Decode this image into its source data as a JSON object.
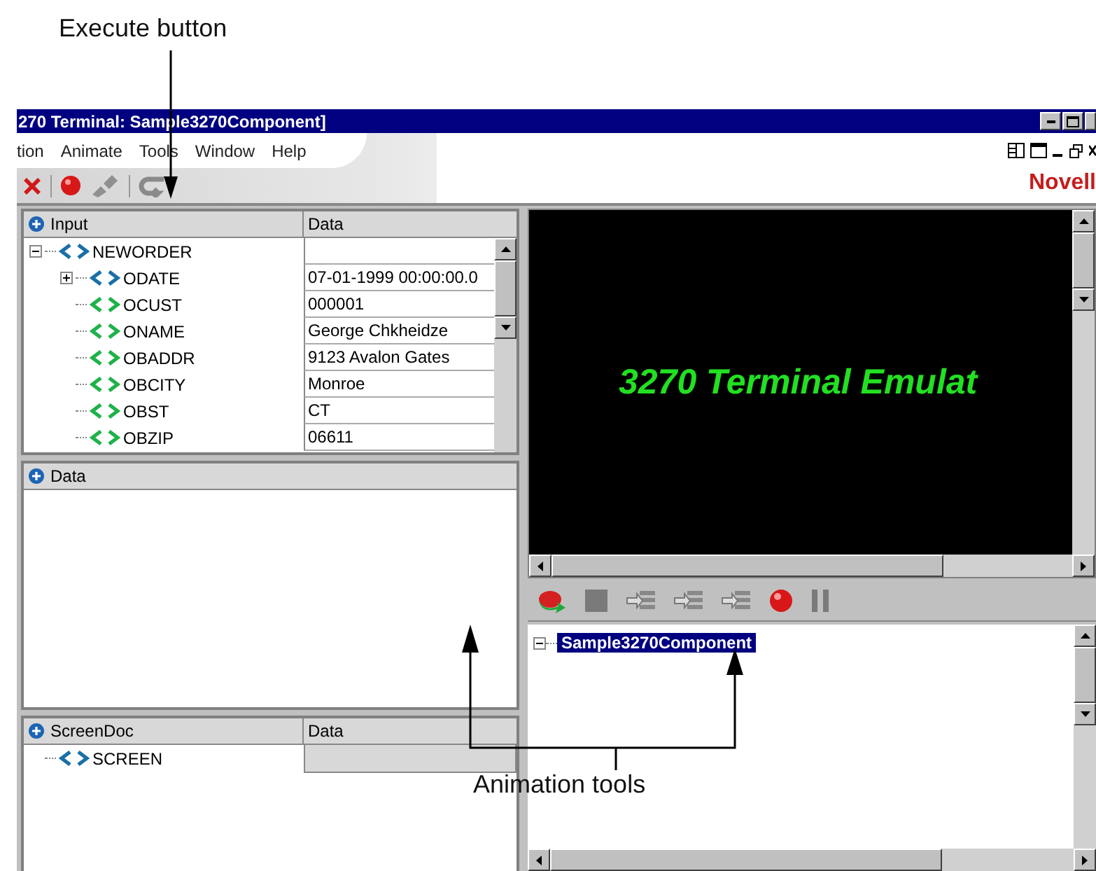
{
  "callouts": {
    "execute": "Execute button",
    "animation": "Animation tools"
  },
  "window": {
    "title": "270 Terminal: Sample3270Component]"
  },
  "menu": [
    "tion",
    "Animate",
    "Tools",
    "Window",
    "Help"
  ],
  "brand": "Novell",
  "input_panel": {
    "columns": [
      "Input",
      "Data"
    ],
    "tree": [
      {
        "name": "NEWORDER",
        "kind": "group",
        "expanded": true,
        "children": [
          {
            "name": "ODATE",
            "kind": "group",
            "expanded": false,
            "value": "07-01-1999 00:00:00.0"
          },
          {
            "name": "OCUST",
            "kind": "field",
            "value": "000001"
          },
          {
            "name": "ONAME",
            "kind": "field",
            "value": "George Chkheidze"
          },
          {
            "name": "OBADDR",
            "kind": "field",
            "value": "9123 Avalon Gates"
          },
          {
            "name": "OBCITY",
            "kind": "field",
            "value": "Monroe"
          },
          {
            "name": "OBST",
            "kind": "field",
            "value": "CT"
          },
          {
            "name": "OBZIP",
            "kind": "field",
            "value": "06611"
          }
        ]
      }
    ]
  },
  "data_panel": {
    "columns": [
      "Data"
    ]
  },
  "screen_doc_panel": {
    "columns": [
      "ScreenDoc",
      "Data"
    ],
    "tree": [
      {
        "name": "SCREEN",
        "kind": "group"
      }
    ]
  },
  "terminal": {
    "text": "3270 Terminal Emulat"
  },
  "component_tree": [
    {
      "name": "Sample3270Component",
      "expanded": true,
      "selected": true
    }
  ]
}
